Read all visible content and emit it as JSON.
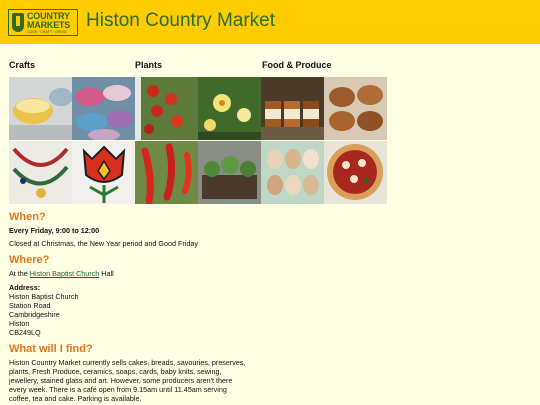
{
  "header": {
    "logo": {
      "line1": "COUNTRY",
      "line2": "MARKETS",
      "tagline": "COOK · CRAFT · GROW"
    },
    "title": "Histon Country Market",
    "background": "#FFCC00",
    "title_color": "#2C6B2F"
  },
  "categories": [
    "Crafts",
    "Plants",
    "Food & Produce"
  ],
  "gallery": [
    "pottery-bowls",
    "knitted-slippers",
    "tomato-plant",
    "flowering-plant",
    "jam-jars",
    "baked-cakes",
    "beaded-necklaces",
    "stained-glass-tulip",
    "chilli-peppers",
    "seedlings",
    "eggs",
    "fruit-tart"
  ],
  "when": {
    "heading": "When?",
    "schedule": "Every Friday, 9:00 to 12:00",
    "closed": "Closed at Christmas, the New Year period and Good Friday"
  },
  "where": {
    "heading": "Where?",
    "prefix": "At the",
    "link": "Histon Baptist Church",
    "suffix": "Hall",
    "address_label": "Address:",
    "address": [
      "Histon Baptist Church",
      "Station Road",
      "Cambridgeshire",
      "Histon",
      "CB249LQ"
    ]
  },
  "find": {
    "heading": "What will I find?",
    "lines": [
      "Histon Country Market currently sells cakes, breads, savouries, preserves,",
      "plants, Fresh Produce, ceramics, soaps, cards, baby knits, sewing,",
      "jewellery, stained glass and art. However, some producers aren't there",
      "every week. There is a café open from 9.15am until 11.45am serving",
      "coffee, tea and cake. Parking is available."
    ]
  },
  "colors": {
    "page": "#FFFFE6",
    "heading": "#E8731A",
    "link": "#1A6B2A"
  }
}
